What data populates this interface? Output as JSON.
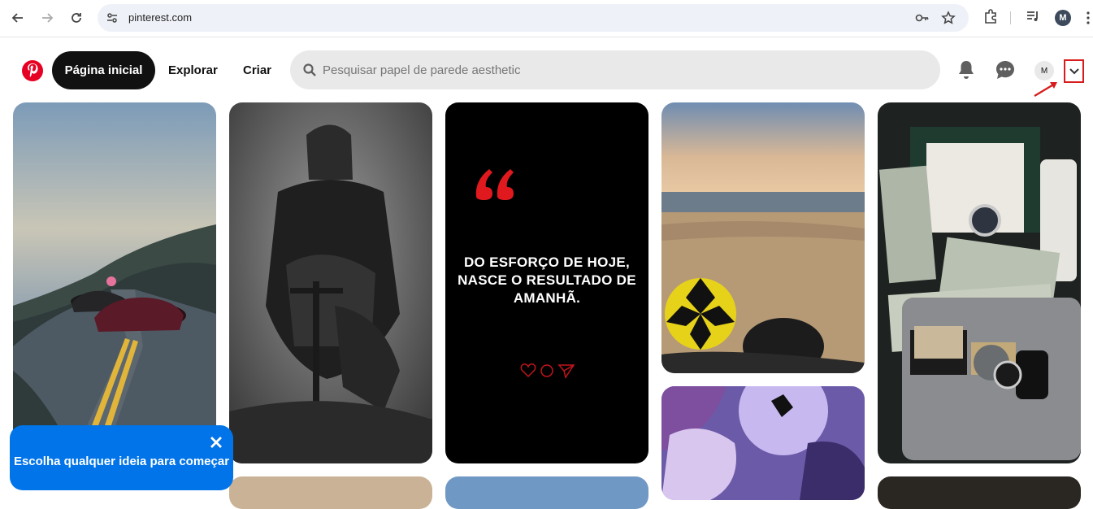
{
  "browser": {
    "url": "pinterest.com",
    "profile_initial": "M"
  },
  "header": {
    "tabs": {
      "home": "Página inicial",
      "explore": "Explorar",
      "create": "Criar"
    },
    "search_placeholder": "Pesquisar papel de parede aesthetic",
    "avatar_initial": "M"
  },
  "pins": {
    "quote_text": "DO ESFORÇO DE HOJE, NASCE O RESULTADO DE AMANHÃ."
  },
  "toast": {
    "message": "Escolha qualquer ideia para começar"
  },
  "colors": {
    "brand": "#e60023",
    "toast": "#0074e8",
    "annotation": "#d81b1b"
  }
}
